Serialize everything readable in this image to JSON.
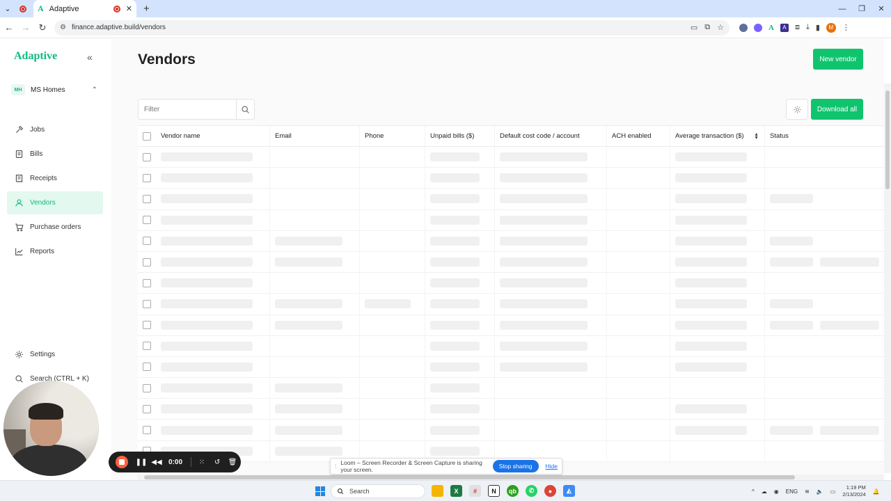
{
  "browser": {
    "tab_title": "Adaptive",
    "url": "finance.adaptive.build/vendors",
    "new_tab_symbol": "+"
  },
  "sidebar": {
    "brand": "Adaptive",
    "org_initials": "MH",
    "org_name": "MS Homes",
    "items": [
      {
        "label": "Jobs",
        "icon": "hammer-icon"
      },
      {
        "label": "Bills",
        "icon": "document-icon"
      },
      {
        "label": "Receipts",
        "icon": "receipt-icon"
      },
      {
        "label": "Vendors",
        "icon": "person-icon",
        "active": true
      },
      {
        "label": "Purchase orders",
        "icon": "cart-icon"
      },
      {
        "label": "Reports",
        "icon": "chart-icon"
      }
    ],
    "settings_label": "Settings",
    "search_label": "Search (CTRL + K)"
  },
  "main": {
    "title": "Vendors",
    "new_vendor_label": "New vendor",
    "filter_placeholder": "Filter",
    "download_label": "Download all",
    "columns": [
      "Vendor name",
      "Email",
      "Phone",
      "Unpaid bills ($)",
      "Default cost code / account",
      "ACH enabled",
      "Average transaction ($)",
      "Status"
    ]
  },
  "recorder": {
    "time": "0:00"
  },
  "share_bar": {
    "message": "Loom – Screen Recorder & Screen Capture is sharing your screen.",
    "stop_label": "Stop sharing",
    "hide_label": "Hide"
  },
  "taskbar": {
    "search_label": "Search",
    "lang": "ENG",
    "time": "1:19 PM",
    "date": "2/13/2024"
  },
  "colors": {
    "accent": "#10c46e",
    "brand": "#10b981",
    "active_bg": "#e3f8ee"
  }
}
